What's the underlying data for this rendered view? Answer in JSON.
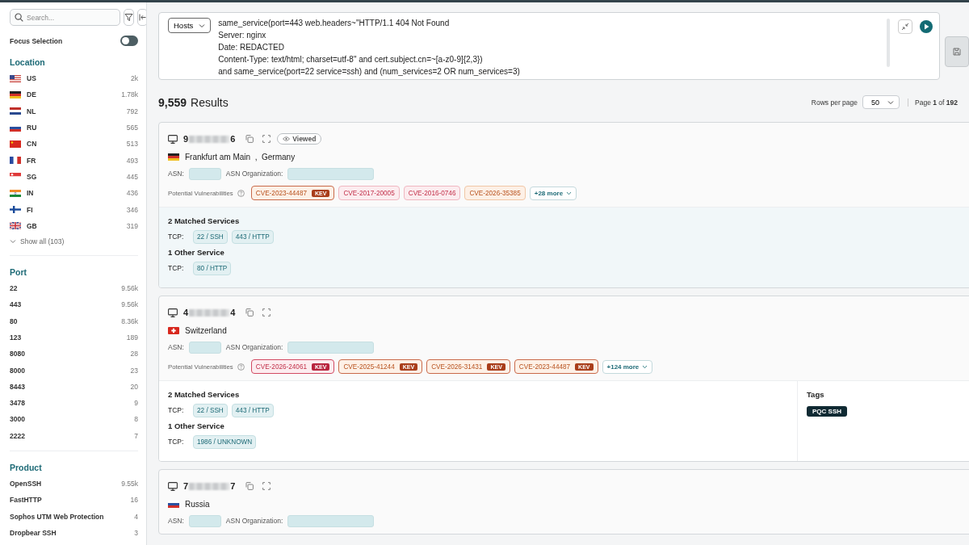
{
  "sidebar": {
    "search": {
      "placeholder": "Search..."
    },
    "focus_selection": {
      "label": "Focus Selection",
      "on": false
    },
    "facets": [
      {
        "title": "Location",
        "items": [
          {
            "flag": {
              "kind": "us"
            },
            "label": "US",
            "count": "2k"
          },
          {
            "flag": {
              "kind": "de"
            },
            "label": "DE",
            "count": "1.78k"
          },
          {
            "flag": {
              "kind": "nl"
            },
            "label": "NL",
            "count": "792"
          },
          {
            "flag": {
              "kind": "ru"
            },
            "label": "RU",
            "count": "565"
          },
          {
            "flag": {
              "kind": "cn"
            },
            "label": "CN",
            "count": "513"
          },
          {
            "flag": {
              "kind": "fr"
            },
            "label": "FR",
            "count": "493"
          },
          {
            "flag": {
              "kind": "sg"
            },
            "label": "SG",
            "count": "445"
          },
          {
            "flag": {
              "kind": "in"
            },
            "label": "IN",
            "count": "436"
          },
          {
            "flag": {
              "kind": "fi"
            },
            "label": "FI",
            "count": "346"
          },
          {
            "flag": {
              "kind": "gb"
            },
            "label": "GB",
            "count": "319"
          }
        ],
        "show_all": "Show all (103)"
      },
      {
        "title": "Port",
        "items": [
          {
            "label": "22",
            "count": "9.56k"
          },
          {
            "label": "443",
            "count": "9.56k"
          },
          {
            "label": "80",
            "count": "8.36k"
          },
          {
            "label": "123",
            "count": "189"
          },
          {
            "label": "8080",
            "count": "28"
          },
          {
            "label": "8000",
            "count": "23"
          },
          {
            "label": "8443",
            "count": "20"
          },
          {
            "label": "3478",
            "count": "9"
          },
          {
            "label": "3000",
            "count": "8"
          },
          {
            "label": "2222",
            "count": "7"
          }
        ]
      },
      {
        "title": "Product",
        "items": [
          {
            "label": "OpenSSH",
            "count": "9.55k"
          },
          {
            "label": "FastHTTP",
            "count": "16"
          },
          {
            "label": "Sophos UTM Web Protection",
            "count": "4"
          },
          {
            "label": "Dropbear SSH",
            "count": "3"
          }
        ]
      }
    ]
  },
  "query": {
    "target": "Hosts",
    "value": "same_service(port=443 web.headers~\"HTTP/1.1 404 Not Found\nServer: nginx\nDate: REDACTED\nContent-Type: text/html; charset=utf-8\" and cert.subject.cn=~[a-z0-9]{2,3})\nand same_service(port=22 service=ssh) and (num_services=2 OR num_services=3)"
  },
  "results": {
    "count": "9,559",
    "label": "Results",
    "rows_label": "Rows per page",
    "rows_value": "50",
    "page": "Page **1** of **192**"
  },
  "hosts": [
    {
      "ip_start": "9",
      "ip_end": "6",
      "viewed": true,
      "viewed_label": "Viewed",
      "flag": {
        "kind": "de"
      },
      "location": "Frankfurt am Main  ,  Germany",
      "asn_label": "ASN:",
      "asn_org_label": "ASN Organization:",
      "vuln_label": "Potential Vulnerabilities",
      "vulns": [
        {
          "id": "CVE-2023-44487",
          "kind": "high",
          "badge": "KEV"
        },
        {
          "id": "CVE-2017-20005",
          "kind": "critical"
        },
        {
          "id": "CVE-2016-0746",
          "kind": "critical"
        },
        {
          "id": "CVE-2026-35385",
          "kind": "high"
        }
      ],
      "more": "+28 more",
      "service_groups": [
        {
          "title": "2 Matched Services",
          "protocol": "TCP:",
          "services": [
            "22 / SSH",
            "443 / HTTP"
          ]
        },
        {
          "title": "1 Other Service",
          "protocol": "TCP:",
          "services": [
            "80 / HTTP"
          ]
        }
      ]
    },
    {
      "ip_start": "4",
      "ip_end": "4",
      "viewed": false,
      "flag": {
        "kind": "ch"
      },
      "location": "Switzerland",
      "asn_label": "ASN:",
      "asn_org_label": "ASN Organization:",
      "vuln_label": "Potential Vulnerabilities",
      "vulns": [
        {
          "id": "CVE-2026-24061",
          "kind": "critical",
          "badge": "KEV"
        },
        {
          "id": "CVE-2025-41244",
          "kind": "high",
          "badge": "KEV"
        },
        {
          "id": "CVE-2026-31431",
          "kind": "high",
          "badge": "KEV"
        },
        {
          "id": "CVE-2023-44487",
          "kind": "high",
          "badge": "KEV"
        }
      ],
      "more": "+124 more",
      "service_groups": [
        {
          "title": "2 Matched Services",
          "protocol": "TCP:",
          "services": [
            "22 / SSH",
            "443 / HTTP"
          ]
        },
        {
          "title": "1 Other Service",
          "protocol": "TCP:",
          "services": [
            "1986 / UNKNOWN"
          ]
        }
      ],
      "tags": {
        "title": "Tags",
        "items": [
          "PQC SSH"
        ]
      }
    },
    {
      "ip_start": "7",
      "ip_end": "7",
      "viewed": false,
      "flag": {
        "kind": "ru"
      },
      "location": "Russia",
      "asn_label": "ASN:",
      "asn_org_label": "ASN Organization:"
    }
  ]
}
